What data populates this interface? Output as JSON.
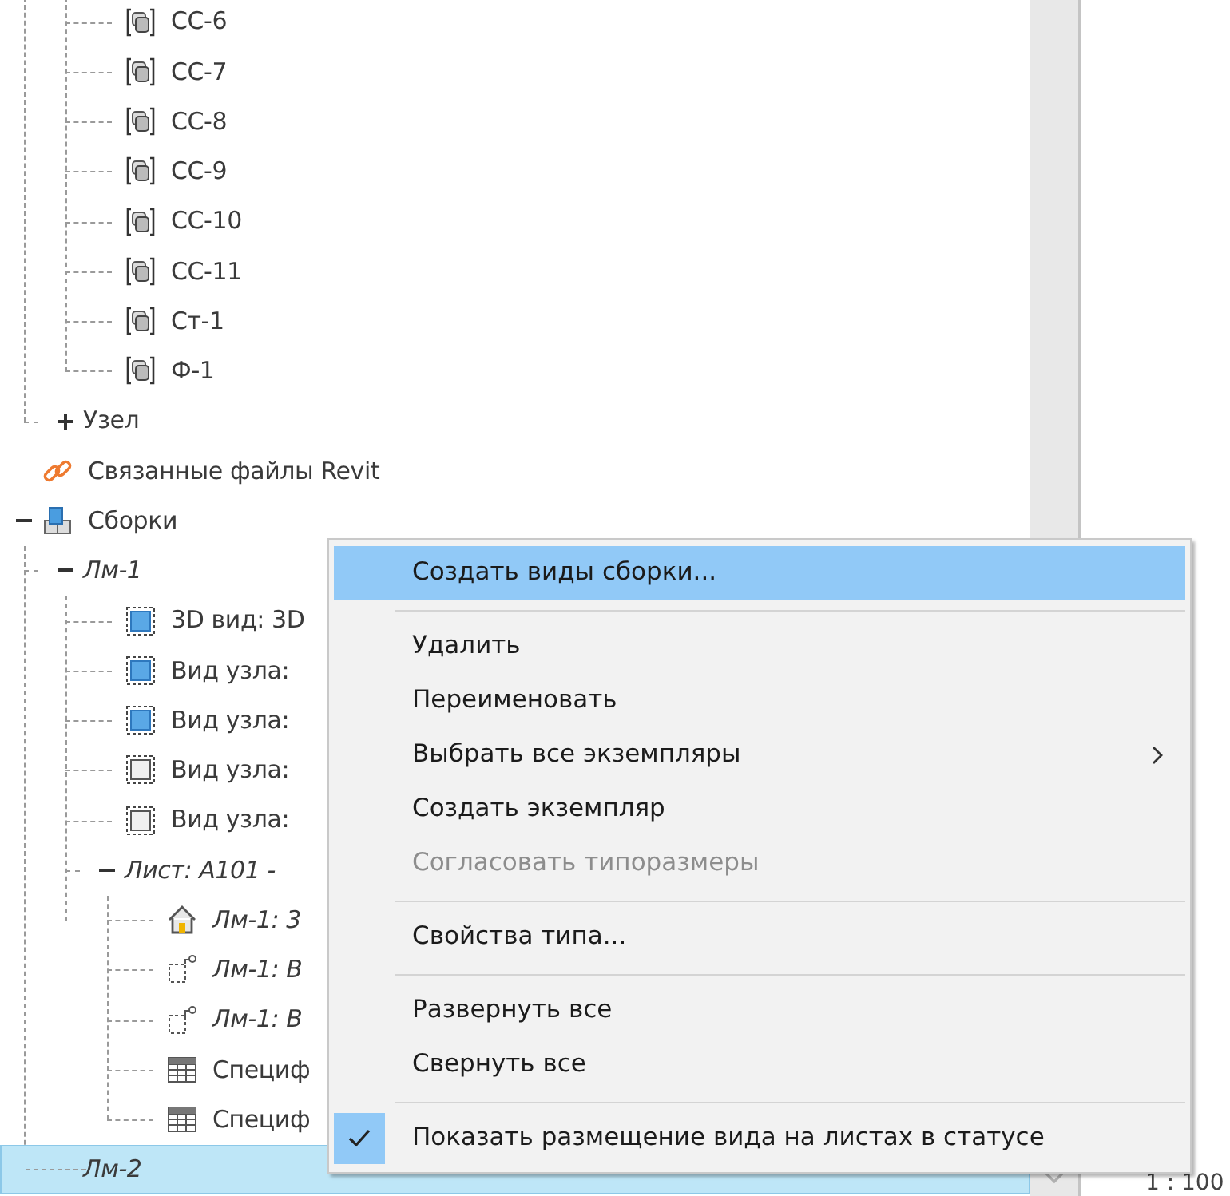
{
  "tree": [
    {
      "children": [
        {
          "children": [
            {
              "label": "СС-6",
              "kind": "family",
              "selected": false
            },
            {
              "label": "СС-7",
              "kind": "family",
              "selected": false
            },
            {
              "label": "СС-8",
              "kind": "family",
              "selected": false
            },
            {
              "label": "СС-9",
              "kind": "family",
              "selected": false
            },
            {
              "label": "СС-10",
              "kind": "family",
              "selected": false
            },
            {
              "label": "СС-11",
              "kind": "family",
              "selected": false
            },
            {
              "label": "Ст-1",
              "kind": "family",
              "selected": false
            },
            {
              "label": "Ф-1",
              "kind": "family",
              "selected": false
            }
          ]
        },
        {
          "label": "Узел",
          "expanded": false,
          "selected": false
        }
      ]
    },
    {
      "label": "Связанные файлы Revit",
      "kind": "link",
      "selected": false
    },
    {
      "label": "Сборки",
      "kind": "assembly",
      "expanded": true,
      "selected": false,
      "children": [
        {
          "label": "Лм-1",
          "italic": true,
          "expanded": true,
          "selected": false,
          "children": [
            {
              "label": "3D вид: 3D",
              "kind": "view-filled",
              "selected": false
            },
            {
              "label": "Вид узла:",
              "kind": "view-filled",
              "selected": false
            },
            {
              "label": "Вид узла:",
              "kind": "view-filled",
              "selected": false
            },
            {
              "label": "Вид узла:",
              "kind": "view-empty",
              "selected": false
            },
            {
              "label": "Вид узла:",
              "kind": "view-empty",
              "selected": false
            },
            {
              "label": "Лист: А101 -",
              "italic": true,
              "expanded": true,
              "selected": false,
              "children": [
                {
                  "label": "Лм-1: 3",
                  "italic": true,
                  "kind": "house",
                  "selected": false
                },
                {
                  "label": "Лм-1: В",
                  "italic": true,
                  "kind": "callout",
                  "selected": false
                },
                {
                  "label": "Лм-1: В",
                  "italic": true,
                  "kind": "callout",
                  "selected": false
                },
                {
                  "label": "Специф",
                  "kind": "schedule",
                  "selected": false
                },
                {
                  "label": "Специф",
                  "kind": "schedule",
                  "selected": false
                }
              ]
            }
          ]
        },
        {
          "label": "Лм-2",
          "italic": true,
          "selected": true
        }
      ]
    }
  ],
  "scale": "1 : 100",
  "context_menu": [
    {
      "kind": "item",
      "label": "Создать виды сборки...",
      "selected": true,
      "disabled": false,
      "checked": false,
      "submenu": false
    },
    {
      "kind": "separator"
    },
    {
      "kind": "item",
      "label": "Удалить",
      "selected": false,
      "disabled": false,
      "checked": false,
      "submenu": false
    },
    {
      "kind": "item",
      "label": "Переименовать",
      "selected": false,
      "disabled": false,
      "checked": false,
      "submenu": false
    },
    {
      "kind": "item",
      "label": "Выбрать все экземпляры",
      "selected": false,
      "disabled": false,
      "checked": false,
      "submenu": true
    },
    {
      "kind": "item",
      "label": "Создать экземпляр",
      "selected": false,
      "disabled": false,
      "checked": false,
      "submenu": false
    },
    {
      "kind": "item",
      "label": "Согласовать типоразмеры",
      "selected": false,
      "disabled": true,
      "checked": false,
      "submenu": false
    },
    {
      "kind": "separator"
    },
    {
      "kind": "item",
      "label": "Свойства типа...",
      "selected": false,
      "disabled": false,
      "checked": false,
      "submenu": false
    },
    {
      "kind": "separator"
    },
    {
      "kind": "item",
      "label": "Развернуть все",
      "selected": false,
      "disabled": false,
      "checked": false,
      "submenu": false
    },
    {
      "kind": "item",
      "label": "Свернуть все",
      "selected": false,
      "disabled": false,
      "checked": false,
      "submenu": false
    },
    {
      "kind": "separator"
    },
    {
      "kind": "item",
      "label": "Показать размещение вида на листах в статусе",
      "selected": false,
      "disabled": false,
      "checked": true,
      "submenu": false
    }
  ]
}
